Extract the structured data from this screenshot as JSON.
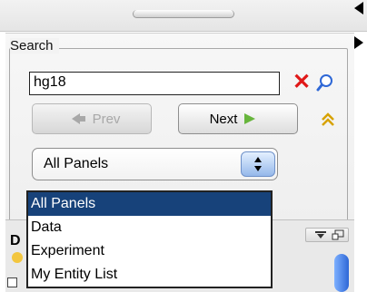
{
  "search": {
    "label": "Search",
    "value": "hg18",
    "prev_label": "Prev",
    "next_label": "Next",
    "clear_icon": "close-icon",
    "find_icon": "magnifier-icon",
    "collapse_icon": "double-chevron-up-icon"
  },
  "panel_select": {
    "selected": "All Panels",
    "options": [
      "All Panels",
      "Data",
      "Experiment",
      "My Entity List"
    ]
  },
  "bottom_panel": {
    "title_letter": "D"
  },
  "colors": {
    "selection": "#17427a",
    "clear": "#e01818",
    "find": "#2e67d6",
    "next_arrow": "#67b53c",
    "scroll": "#2e67d6"
  }
}
